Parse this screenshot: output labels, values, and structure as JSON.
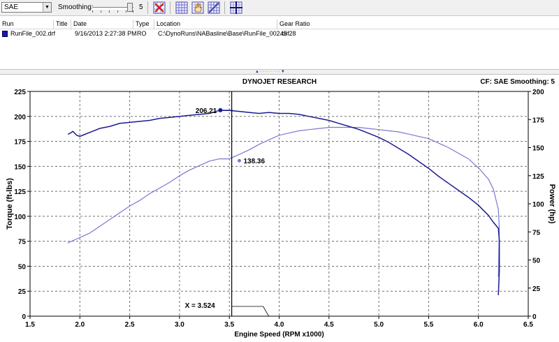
{
  "toolbar": {
    "unit_value": "SAE",
    "smoothing_label": "Smoothing:",
    "smoothing_value": "5",
    "buttons": [
      "clear-runs-icon",
      "grid-view-icon",
      "hand-pan-icon",
      "grid-zoom-icon",
      "crosshair-grid-icon"
    ]
  },
  "run_table": {
    "headers": [
      "Run",
      "Title",
      "Date",
      "Type",
      "Location",
      "Gear Ratio"
    ],
    "rows": [
      {
        "run": "RunFile_002.drf",
        "title": "",
        "date": "9/16/2013 2:27:38 PM",
        "type": "RO",
        "location": "C:\\DynoRuns\\NABasline\\Base\\RunFile_002.drf",
        "gear_ratio": "45.28",
        "color": "#1a1aa8"
      }
    ]
  },
  "chart_header": {
    "title": "DYNOJET RESEARCH",
    "cf_label": "CF: SAE  Smoothing: 5"
  },
  "chart_data": {
    "type": "line",
    "xlabel": "Engine Speed (RPM x1000)",
    "ylabel_left": "Torque (ft-lbs)",
    "ylabel_right": "Power (hp)",
    "xlim": [
      1.5,
      6.5
    ],
    "ylim_left": [
      0,
      225
    ],
    "ylim_right": [
      0,
      200
    ],
    "x_ticks": [
      "1.5",
      "2.0",
      "2.5",
      "3.0",
      "3.5",
      "4.0",
      "4.5",
      "5.0",
      "5.5",
      "6.0",
      "6.5"
    ],
    "y_ticks_left": [
      "0",
      "25",
      "50",
      "75",
      "100",
      "125",
      "150",
      "175",
      "200",
      "225"
    ],
    "y_ticks_right": [
      "0",
      "25",
      "50",
      "75",
      "100",
      "125",
      "150",
      "175",
      "200"
    ],
    "grid": "dashed",
    "cursor": {
      "x": 3.524,
      "label": "X = 3.524"
    },
    "annotations": [
      {
        "series": "Torque",
        "x": 3.41,
        "y": 206.21,
        "label": "206.21"
      },
      {
        "series": "Power",
        "x": 3.6,
        "y": 138.36,
        "label": "138.36"
      }
    ],
    "colors": {
      "torque": "#1b1b8e",
      "power": "#7878d2"
    },
    "series": [
      {
        "axis": "left",
        "x": [
          1.88,
          1.9,
          1.93,
          1.97,
          2.0,
          2.05,
          2.1,
          2.2,
          2.3,
          2.4,
          2.5,
          2.6,
          2.7,
          2.8,
          2.9,
          3.0,
          3.1,
          3.2,
          3.3,
          3.4,
          3.5,
          3.6,
          3.7,
          3.8,
          3.9,
          4.0,
          4.1,
          4.2,
          4.3,
          4.4,
          4.5,
          4.6,
          4.7,
          4.8,
          4.9,
          5.0,
          5.1,
          5.2,
          5.3,
          5.4,
          5.5,
          5.6,
          5.7,
          5.8,
          5.9,
          6.0,
          6.05,
          6.1,
          6.15,
          6.2,
          6.21,
          6.21,
          6.2
        ],
        "y": [
          182,
          183,
          185,
          181,
          180,
          182,
          184,
          188,
          190,
          193,
          194,
          195,
          196,
          198,
          199,
          200,
          201,
          202,
          203,
          206,
          206,
          205,
          204,
          203,
          204,
          203,
          203,
          202,
          200,
          198,
          196,
          193,
          190,
          187,
          183,
          179,
          174,
          168,
          162,
          155,
          148,
          140,
          133,
          126,
          119,
          111,
          106,
          101,
          94,
          88,
          76,
          45,
          21
        ]
      },
      {
        "axis": "right",
        "x": [
          1.88,
          1.9,
          1.95,
          2.0,
          2.1,
          2.2,
          2.3,
          2.4,
          2.5,
          2.6,
          2.7,
          2.8,
          2.9,
          3.0,
          3.1,
          3.2,
          3.3,
          3.4,
          3.5,
          3.6,
          3.7,
          3.8,
          3.9,
          4.0,
          4.1,
          4.2,
          4.3,
          4.4,
          4.5,
          4.6,
          4.7,
          4.8,
          4.9,
          5.0,
          5.1,
          5.2,
          5.3,
          5.4,
          5.5,
          5.6,
          5.7,
          5.8,
          5.9,
          6.0,
          6.1,
          6.15,
          6.2,
          6.21,
          6.2
        ],
        "y": [
          65,
          66,
          68,
          70,
          74,
          80,
          86,
          92,
          98,
          103,
          109,
          114,
          119,
          125,
          130,
          134,
          138,
          140,
          140,
          144,
          148,
          153,
          157,
          161,
          163,
          165,
          166,
          167,
          168,
          168,
          168,
          168,
          167,
          166,
          165,
          164,
          162,
          160,
          158,
          154,
          150,
          145,
          140,
          132,
          122,
          113,
          95,
          78,
          35
        ]
      }
    ]
  }
}
